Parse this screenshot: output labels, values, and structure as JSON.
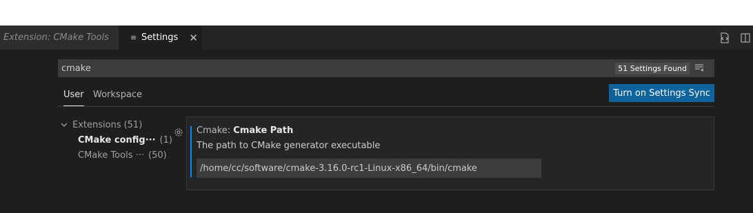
{
  "tabs": [
    {
      "label": "Extension: CMake Tools",
      "active": false
    },
    {
      "label": "Settings",
      "active": true
    }
  ],
  "search": {
    "query": "cmake",
    "results_count": "51 Settings Found"
  },
  "scopes": {
    "user": "User",
    "workspace": "Workspace"
  },
  "sync_button": "Turn on Settings Sync",
  "toc": {
    "root": {
      "label": "Extensions",
      "count": "(51)"
    },
    "children": [
      {
        "label": "CMake config···",
        "count": "(1)"
      },
      {
        "label": "CMake Tools ···",
        "count": "(50)"
      }
    ]
  },
  "setting": {
    "category": "Cmake: ",
    "name": "Cmake Path",
    "description": "The path to CMake generator executable",
    "value": "/home/cc/software/cmake-3.16.0-rc1-Linux-x86_64/bin/cmake"
  },
  "colors": {
    "accent": "#0e639c",
    "focus_bar": "#0090f1",
    "editor_bg": "#1e1e1e"
  },
  "icons": {
    "settings_tab": "list-icon",
    "close": "close-icon",
    "clear_filter": "clear-filter-icon",
    "open_json": "open-json-icon",
    "split": "split-editor-icon",
    "gear": "gear-icon",
    "chevron": "chevron-down-icon"
  }
}
